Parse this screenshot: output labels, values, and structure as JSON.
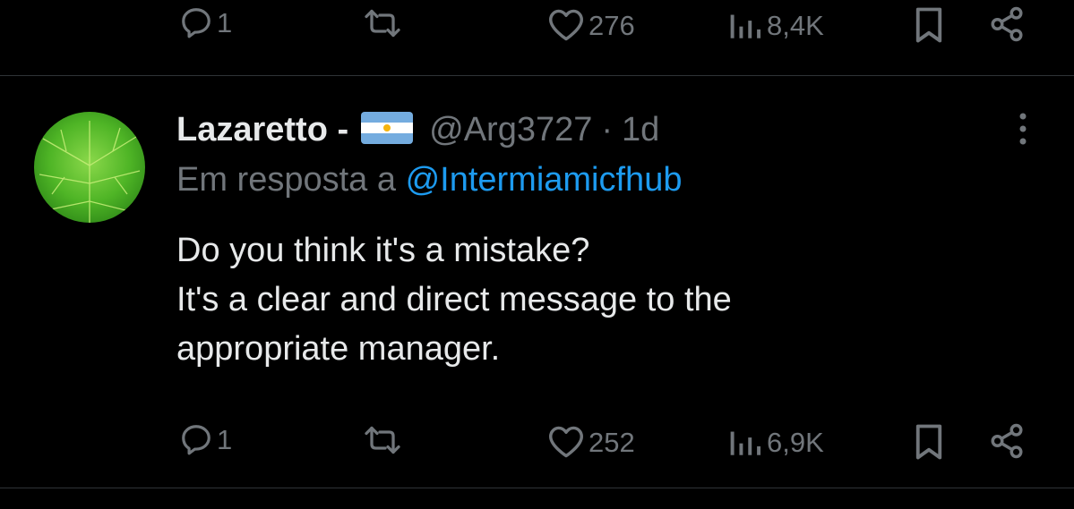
{
  "top_actions": {
    "replies": "1",
    "likes": "276",
    "views": "8,4K"
  },
  "tweet": {
    "display_name": "Lazaretto -",
    "handle": "@Arg3727",
    "separator": "·",
    "time": "1d",
    "flag_icon": "argentina-flag-icon",
    "reply_prefix": "Em resposta a",
    "reply_to": "@Intermiamicfhub",
    "text_lines": [
      "Do you think it's a mistake?",
      "It's a clear and direct message to the",
      "appropriate manager."
    ],
    "actions": {
      "replies": "1",
      "likes": "252",
      "views": "6,9K"
    }
  },
  "colors": {
    "background": "#000000",
    "text": "#e7e9ea",
    "muted": "#71767b",
    "link": "#1d9bf0",
    "divider": "#2f3336"
  }
}
